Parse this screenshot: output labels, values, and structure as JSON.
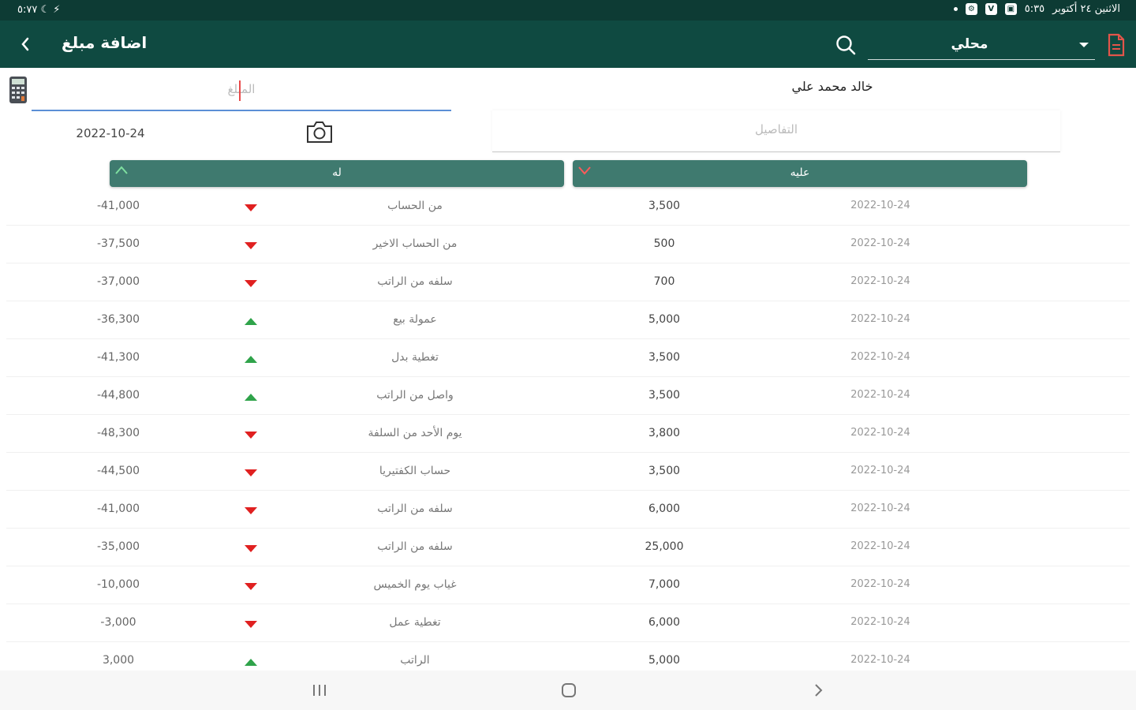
{
  "status_bar": {
    "time_left": "٥:٧٧ ☾ ⚡",
    "date_text": "الاثنين ٢٤ أكتوبر",
    "time": "٥:٣٥"
  },
  "appbar": {
    "title": "اضافة مبلغ",
    "currency": "محلي"
  },
  "form": {
    "customer_name": "خالد محمد علي",
    "amount_placeholder": "المبلغ",
    "details_placeholder": "التفاصيل",
    "date": "2022-10-24"
  },
  "actions": {
    "lah_label": "له",
    "alayh_label": "عليه"
  },
  "colors": {
    "status_bar": "#0d3b34",
    "appbar": "#0f4a41",
    "button": "#3f7a6f",
    "down_arrow": "#e02020",
    "up_arrow": "#2fa34a"
  },
  "transactions": [
    {
      "balance": "-41,000",
      "direction": "down",
      "description": "من الحساب",
      "amount": "3,500",
      "date": "2022-10-24"
    },
    {
      "balance": "-37,500",
      "direction": "down",
      "description": "من الحساب الاخير",
      "amount": "500",
      "date": "2022-10-24"
    },
    {
      "balance": "-37,000",
      "direction": "down",
      "description": "سلفه من الراتب",
      "amount": "700",
      "date": "2022-10-24"
    },
    {
      "balance": "-36,300",
      "direction": "up",
      "description": "عمولة بيع",
      "amount": "5,000",
      "date": "2022-10-24"
    },
    {
      "balance": "-41,300",
      "direction": "up",
      "description": "تغطية بدل",
      "amount": "3,500",
      "date": "2022-10-24"
    },
    {
      "balance": "-44,800",
      "direction": "up",
      "description": "واصل من الراتب",
      "amount": "3,500",
      "date": "2022-10-24"
    },
    {
      "balance": "-48,300",
      "direction": "down",
      "description": "يوم الأحد من السلفة",
      "amount": "3,800",
      "date": "2022-10-24"
    },
    {
      "balance": "-44,500",
      "direction": "down",
      "description": "حساب الكفتيريا",
      "amount": "3,500",
      "date": "2022-10-24"
    },
    {
      "balance": "-41,000",
      "direction": "down",
      "description": "سلفه من الراتب",
      "amount": "6,000",
      "date": "2022-10-24"
    },
    {
      "balance": "-35,000",
      "direction": "down",
      "description": "سلفه من الراتب",
      "amount": "25,000",
      "date": "2022-10-24"
    },
    {
      "balance": "-10,000",
      "direction": "down",
      "description": "غياب يوم الخميس",
      "amount": "7,000",
      "date": "2022-10-24"
    },
    {
      "balance": "-3,000",
      "direction": "down",
      "description": "تغطية عمل",
      "amount": "6,000",
      "date": "2022-10-24"
    },
    {
      "balance": "3,000",
      "direction": "up",
      "description": "الراتب",
      "amount": "5,000",
      "date": "2022-10-24"
    }
  ]
}
